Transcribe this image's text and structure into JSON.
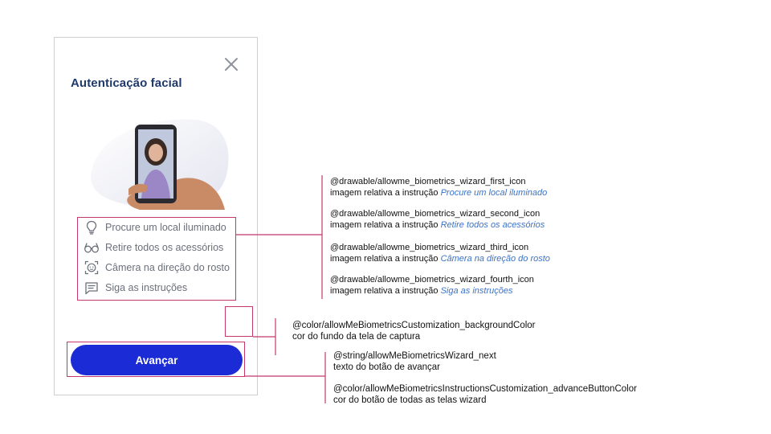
{
  "screen": {
    "title": "Autenticação facial",
    "close_icon": "close-icon",
    "instructions": [
      {
        "icon": "lightbulb-icon",
        "label": "Procure um local iluminado"
      },
      {
        "icon": "glasses-icon",
        "label": "Retire todos os acessórios"
      },
      {
        "icon": "face-frame-icon",
        "label": "Câmera na direção do rosto"
      },
      {
        "icon": "chat-icon",
        "label": "Siga as instruções"
      }
    ],
    "advance_button": {
      "label": "Avançar",
      "color": "#1b2bd6"
    }
  },
  "annotations": {
    "icons": [
      {
        "resource": "@drawable/allowme_biometrics_wizard_first_icon",
        "desc": "imagem relativa a instrução",
        "instr": "Procure um local iluminado"
      },
      {
        "resource": "@drawable/allowme_biometrics_wizard_second_icon",
        "desc": "imagem relativa a instrução",
        "instr": "Retire todos os acessórios"
      },
      {
        "resource": "@drawable/allowme_biometrics_wizard_third_icon",
        "desc": "imagem relativa a instrução",
        "instr": "Câmera na direção do rosto"
      },
      {
        "resource": "@drawable/allowme_biometrics_wizard_fourth_icon",
        "desc": "imagem relativa a instrução",
        "instr": "Siga as instruções"
      }
    ],
    "background": {
      "resource": "@color/allowMeBiometricsCustomization_backgroundColor",
      "desc": "cor do fundo da tela de captura"
    },
    "next_string": {
      "resource": "@string/allowMeBiometricsWizard_next",
      "desc": "texto do botão de avançar"
    },
    "button_color": {
      "resource": "@color/allowMeBiometricsInstructionsCustomization_advanceButtonColor",
      "desc": "cor do botão de todas as telas wizard"
    }
  },
  "colors": {
    "title": "#20396b",
    "annotation_line": "#c4386c",
    "annotation_italic": "#3b73c8"
  }
}
